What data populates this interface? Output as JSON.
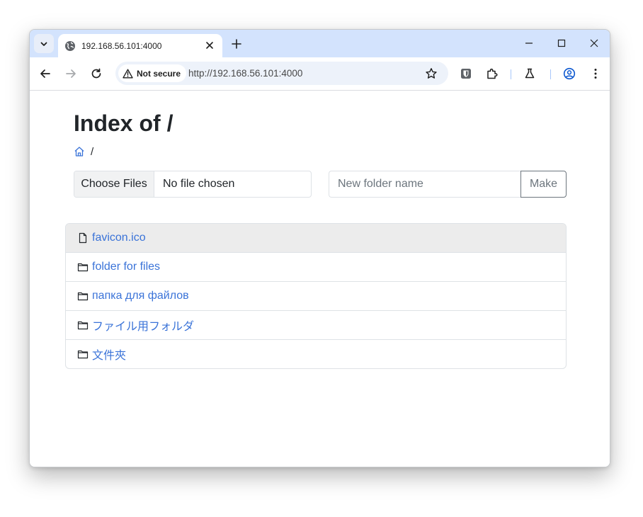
{
  "browser": {
    "tab": {
      "title": "192.168.56.101:4000"
    },
    "omnibox": {
      "security_label": "Not secure",
      "url": "http://192.168.56.101:4000"
    }
  },
  "page": {
    "title": "Index of /",
    "breadcrumb": {
      "separator": "/"
    },
    "upload": {
      "button_label": "Choose Files",
      "status": "No file chosen"
    },
    "new_folder": {
      "placeholder": "New folder name",
      "button_label": "Make"
    },
    "entries": [
      {
        "name": "favicon.ico",
        "icon": "file-icon"
      },
      {
        "name": "folder for files",
        "icon": "folder-icon"
      },
      {
        "name": "папка для файлов",
        "icon": "folder-icon"
      },
      {
        "name": "ファイル用フォルダ",
        "icon": "folder-icon"
      },
      {
        "name": "文件夾",
        "icon": "folder-icon"
      }
    ]
  },
  "colors": {
    "tab_strip": "#d3e3fd",
    "link": "#3a73d8",
    "active_row": "#ececec",
    "omnibox": "#edf2fa"
  }
}
